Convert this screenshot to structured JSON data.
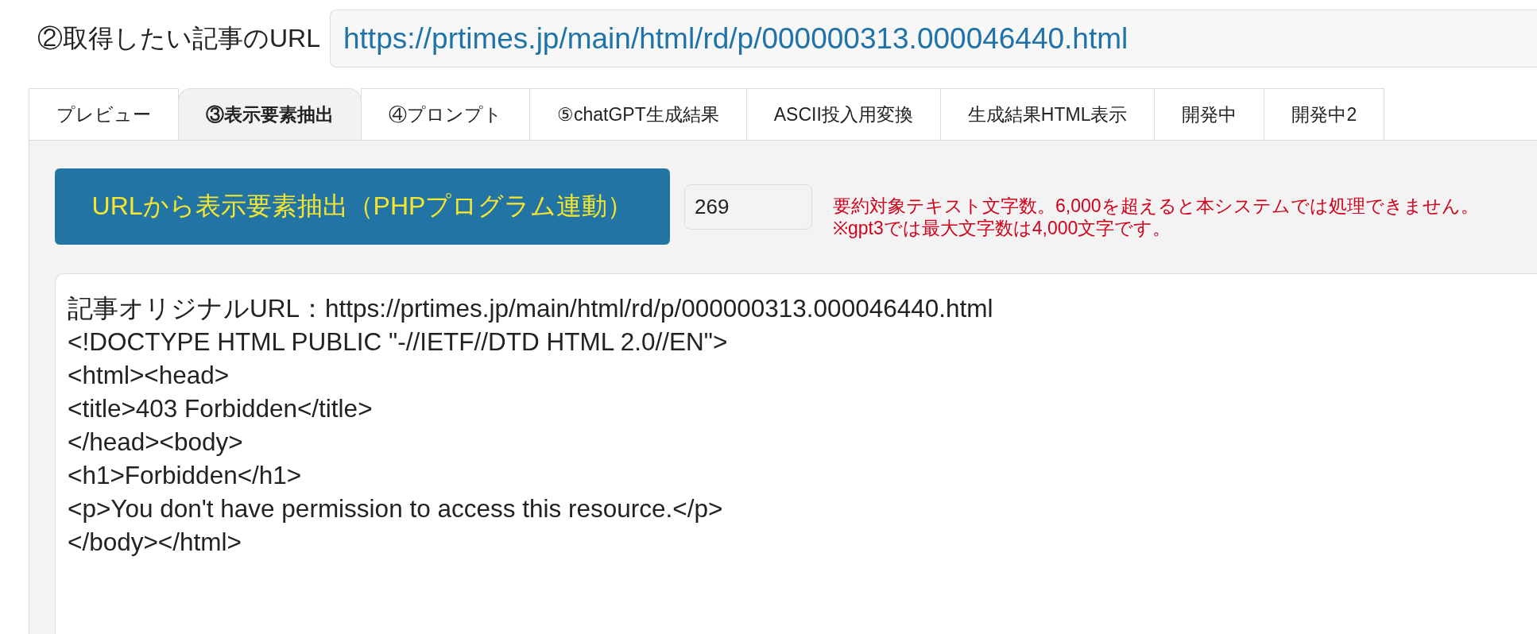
{
  "url_field": {
    "label": "②取得したい記事のURL",
    "value": "https://prtimes.jp/main/html/rd/p/000000313.000046440.html"
  },
  "tabs": [
    {
      "label": "プレビュー",
      "selected": false
    },
    {
      "label": "③表示要素抽出",
      "selected": true
    },
    {
      "label": "④プロンプト",
      "selected": false
    },
    {
      "label": "⑤chatGPT生成結果",
      "selected": false
    },
    {
      "label": "ASCII投入用変換",
      "selected": false
    },
    {
      "label": "生成結果HTML表示",
      "selected": false
    },
    {
      "label": "開発中",
      "selected": false
    },
    {
      "label": "開発中2",
      "selected": false
    }
  ],
  "extract_button": {
    "label": "URLから表示要素抽出（PHPプログラム連動）"
  },
  "char_count": {
    "value": "269"
  },
  "notice": [
    "要約対象テキスト文字数。6,000を超えると本システムでは処理できません。",
    "※gpt3では最大文字数は4,000文字です。"
  ],
  "output": {
    "lines": [
      "記事オリジナルURL：https://prtimes.jp/main/html/rd/p/000000313.000046440.html",
      "<!DOCTYPE HTML PUBLIC \"-//IETF//DTD HTML 2.0//EN\">",
      "<html><head>",
      "<title>403 Forbidden</title>",
      "</head><body>",
      "<h1>Forbidden</h1>",
      "<p>You don't have permission to access this resource.</p>",
      "</body></html>"
    ]
  }
}
